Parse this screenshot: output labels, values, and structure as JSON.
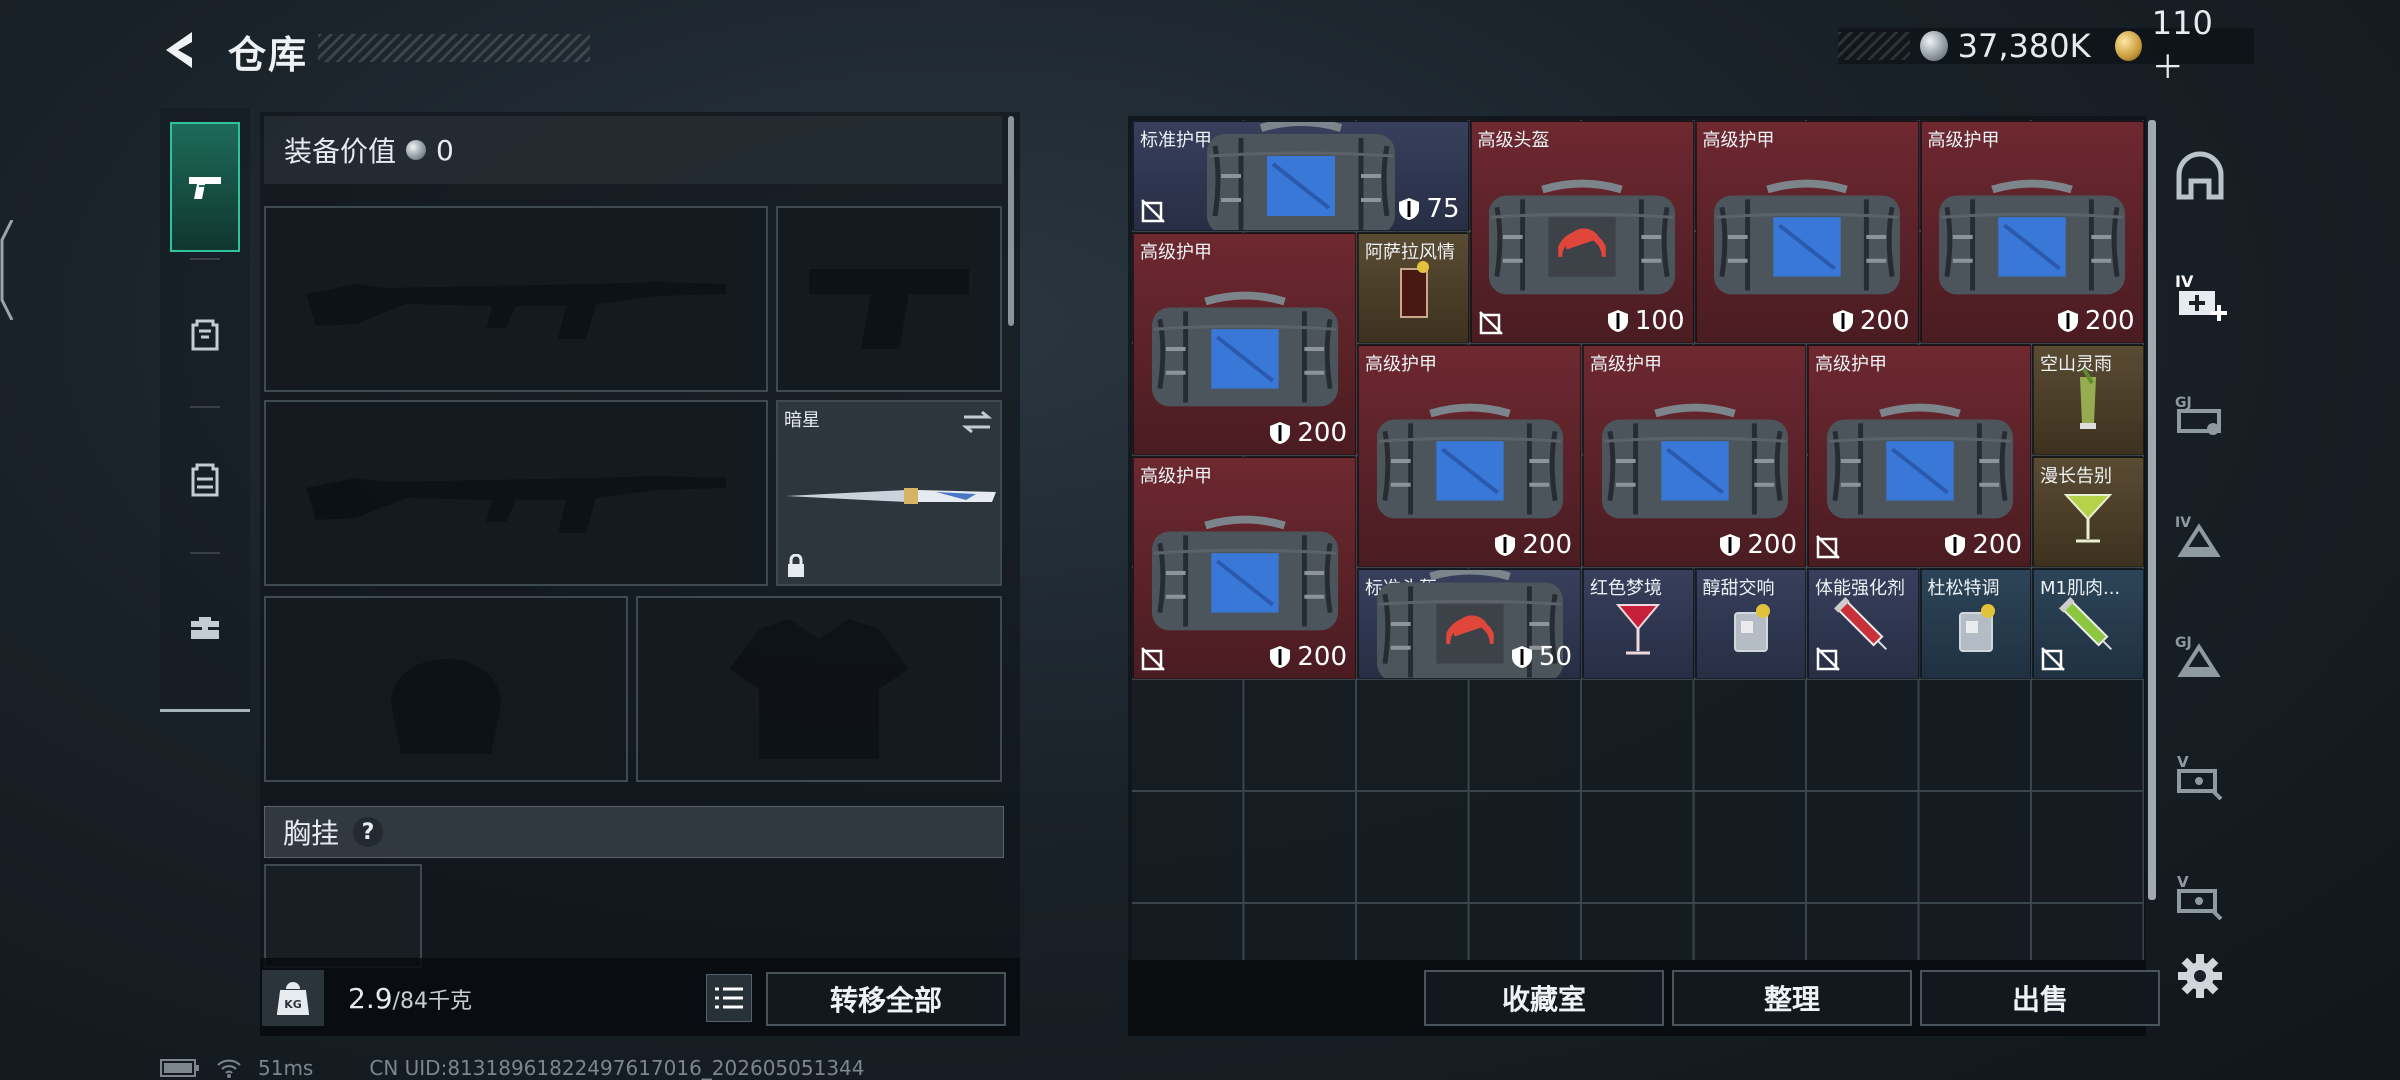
{
  "header": {
    "title": "仓库",
    "currency_silver": "37,380K",
    "currency_gold": "110＋",
    "silver_color": "#b9c3c9",
    "gold_color": "#d7b463"
  },
  "left_tabs": [
    {
      "icon": "pistol-icon",
      "active": true
    },
    {
      "icon": "backpack-icon",
      "active": false
    },
    {
      "icon": "vest-icon",
      "active": false
    },
    {
      "icon": "toolbox-icon",
      "active": false
    }
  ],
  "equipment": {
    "value_label": "装备价值",
    "value": "0",
    "melee_label": "暗星",
    "chest_label": "胸挂",
    "chest_help": "?",
    "weight_current": "2.9",
    "weight_max": "/84千克",
    "transfer_all": "转移全部"
  },
  "inventory": {
    "items": [
      {
        "name": "标准护甲",
        "value": "75",
        "kind": "bag",
        "bg": "navy",
        "no_drop": true
      },
      {
        "name": "高级头盔",
        "value": "100",
        "kind": "helmet-bag",
        "bg": "red",
        "no_drop": true
      },
      {
        "name": "高级护甲",
        "value": "200",
        "kind": "bag",
        "bg": "red",
        "no_drop": false
      },
      {
        "name": "高级护甲",
        "value": "200",
        "kind": "bag",
        "bg": "red",
        "no_drop": false
      },
      {
        "name": "高级护甲",
        "value": "200",
        "kind": "bag",
        "bg": "red",
        "no_drop": false
      },
      {
        "name": "阿萨拉风情",
        "value": "",
        "kind": "drink-cola",
        "bg": "brown",
        "no_drop": false
      },
      {
        "name": "高级护甲",
        "value": "200",
        "kind": "bag",
        "bg": "red",
        "no_drop": false
      },
      {
        "name": "高级护甲",
        "value": "200",
        "kind": "bag",
        "bg": "red",
        "no_drop": false
      },
      {
        "name": "高级护甲",
        "value": "200",
        "kind": "bag",
        "bg": "red",
        "no_drop": true
      },
      {
        "name": "空山灵雨",
        "value": "",
        "kind": "drink-green",
        "bg": "brown",
        "no_drop": false
      },
      {
        "name": "漫长告别",
        "value": "",
        "kind": "drink-martini",
        "bg": "brown",
        "no_drop": false
      },
      {
        "name": "高级护甲",
        "value": "200",
        "kind": "bag",
        "bg": "red",
        "no_drop": true
      },
      {
        "name": "标准头盔",
        "value": "50",
        "kind": "helmet-bag",
        "bg": "navy",
        "no_drop": false
      },
      {
        "name": "红色梦境",
        "value": "",
        "kind": "drink-red",
        "bg": "navy",
        "no_drop": false
      },
      {
        "name": "醇甜交响",
        "value": "",
        "kind": "drink-whisky",
        "bg": "navy",
        "no_drop": false
      },
      {
        "name": "体能强化剂",
        "value": "",
        "kind": "syringe-red",
        "bg": "navy",
        "no_drop": true
      },
      {
        "name": "杜松特调",
        "value": "",
        "kind": "drink-whisky",
        "bg": "blue",
        "no_drop": false
      },
      {
        "name": "M1肌肉...",
        "value": "",
        "kind": "syringe-green",
        "bg": "blue",
        "no_drop": true
      }
    ],
    "buttons": {
      "collection": "收藏室",
      "sort": "整理",
      "sell": "出售"
    }
  },
  "side_icons": [
    "safehouse-icon",
    "add-medkit-tier4-icon",
    "tier-stack-icon",
    "tier4-armor-icon",
    "tier-armor-icon",
    "tier5-key-icon",
    "tier5-key-icon-2",
    "settings-gear-icon"
  ],
  "footer": {
    "ping": "51ms",
    "uid": "CN UID:8131896182249761​7016_202605051344"
  }
}
